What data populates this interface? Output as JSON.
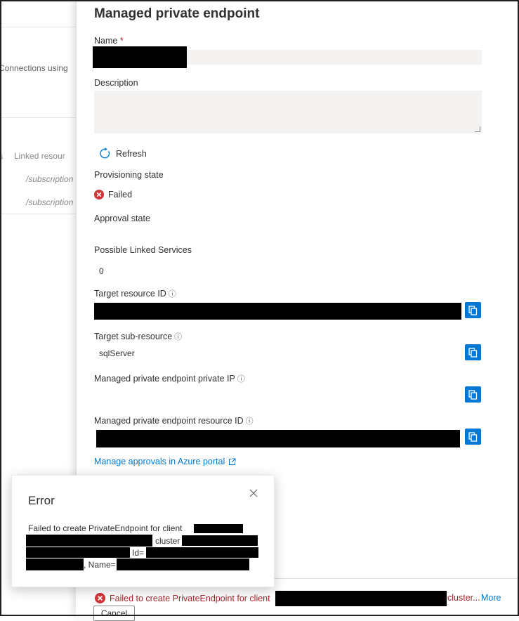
{
  "left_pane": {
    "connections_text": "Connections using",
    "linked_header": "Linked resour",
    "rows": [
      "/subscription",
      "/subscription"
    ]
  },
  "panel": {
    "title": "Managed private endpoint",
    "name_label": "Name",
    "required_marker": "*",
    "description_label": "Description",
    "refresh_label": "Refresh",
    "provisioning_state_label": "Provisioning state",
    "provisioning_state_value": "Failed",
    "approval_state_label": "Approval state",
    "possible_linked_label": "Possible Linked Services",
    "possible_linked_value": "0",
    "target_resource_id_label": "Target resource ID",
    "target_sub_resource_label": "Target sub-resource",
    "target_sub_resource_value": "sqlServer",
    "private_ip_label": "Managed private endpoint private IP",
    "resource_id_label": "Managed private endpoint resource ID",
    "manage_link": "Manage approvals in Azure portal",
    "info_glyph": "ⓘ"
  },
  "error_dialog": {
    "title": "Error",
    "line1": "Failed to create PrivateEndpoint for client",
    "line2": "cluster",
    "line3": "Id=",
    "line4": ", Name="
  },
  "notification": {
    "message": "Failed to create PrivateEndpoint for client",
    "cluster_text": "cluster...",
    "more_label": "More",
    "cancel_label": "Cancel"
  },
  "colors": {
    "accent": "#0078d4",
    "error": "#d13438",
    "error_text": "#a4262c"
  }
}
